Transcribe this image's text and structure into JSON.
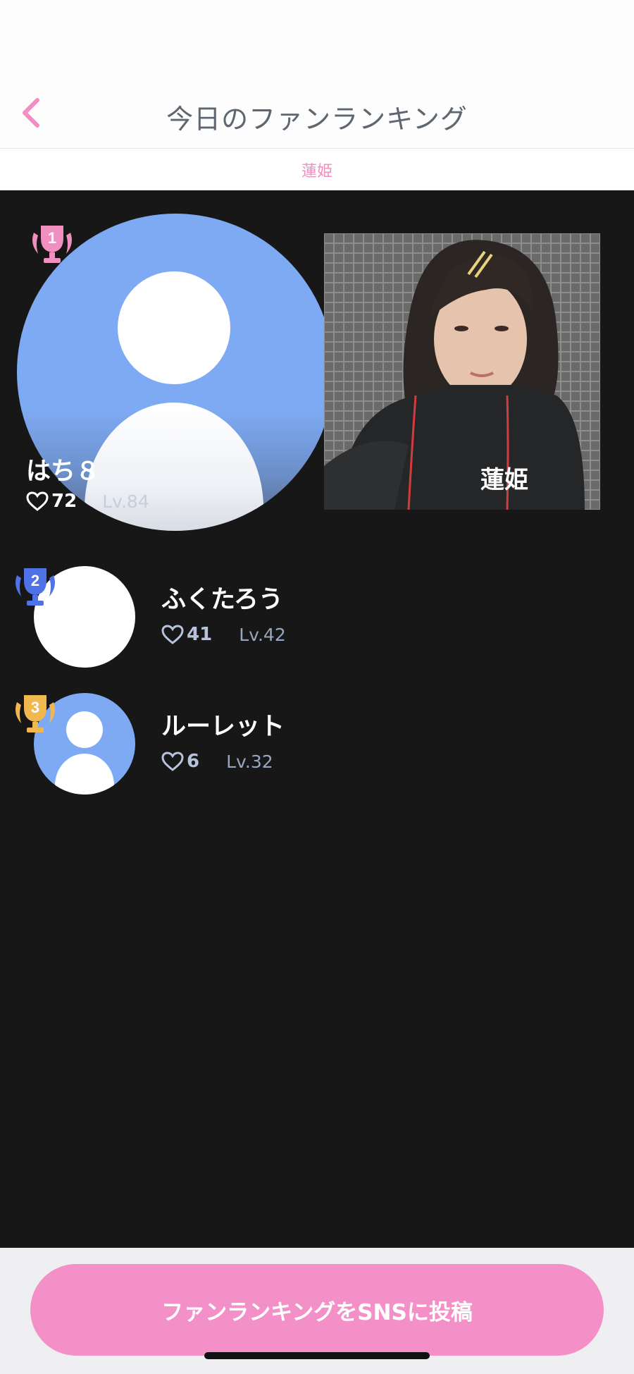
{
  "header": {
    "title": "今日のファンランキング",
    "back_icon": "chevron-left-icon"
  },
  "subheader": {
    "streamer": "蓮姫"
  },
  "streamer_card": {
    "name": "蓮姫"
  },
  "ranking": [
    {
      "rank": "1",
      "name": "はち８",
      "likes": "72",
      "level": "Lv.84",
      "trophy_color": "#f08fc0"
    },
    {
      "rank": "2",
      "name": "ふくたろう",
      "likes": "41",
      "level": "Lv.42",
      "trophy_color": "#4f72e6"
    },
    {
      "rank": "3",
      "name": "ルーレット",
      "likes": "6",
      "level": "Lv.32",
      "trophy_color": "#f0b84f"
    }
  ],
  "footer": {
    "share_label": "ファンランキングをSNSに投稿"
  },
  "colors": {
    "accent": "#f390c8",
    "background": "#171717",
    "avatar_blue": "#7eaaf3"
  }
}
